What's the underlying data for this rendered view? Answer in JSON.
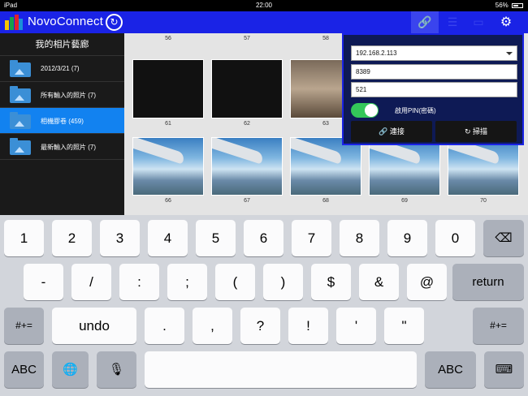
{
  "status_bar": {
    "carrier": "iPad",
    "time": "22:00",
    "battery": "56%"
  },
  "header": {
    "app_name": "NovoConnect",
    "refresh_glyph": "↻",
    "link_glyph": "🔗",
    "list_glyph": "☰",
    "screen_glyph": "▭",
    "settings_glyph": "⚙",
    "accent_color": "#1a23e6"
  },
  "sidebar": {
    "title": "我的相片藝廊",
    "items": [
      {
        "label": "2012/3/21 (7)"
      },
      {
        "label": "所有輸入的照片 (7)"
      },
      {
        "label": "相機膠卷 (459)",
        "selected": true
      },
      {
        "label": "最新輸入的照片 (7)"
      }
    ]
  },
  "gallery": {
    "row1": [
      "56",
      "57",
      "58"
    ],
    "row2": [
      "61",
      "62",
      "63"
    ],
    "row3": [
      "66",
      "67",
      "68",
      "69",
      "70"
    ]
  },
  "popover": {
    "ip_address": "192.168.2.113",
    "port": "8389",
    "pin": "521",
    "pin_label": "啟用PIN(密碼)",
    "connect_label": "連接",
    "scan_label": "掃描"
  },
  "keyboard": {
    "row1": [
      "1",
      "2",
      "3",
      "4",
      "5",
      "6",
      "7",
      "8",
      "9",
      "0"
    ],
    "delete_glyph": "⌫",
    "row2": [
      "-",
      "/",
      ":",
      ";",
      "(",
      ")",
      "$",
      "&",
      "@"
    ],
    "return_label": "return",
    "row3_left": "#+=",
    "undo_label": "undo",
    "row3": [
      ".",
      ",",
      "?",
      "!",
      "'",
      "\""
    ],
    "row3_right": "#+=",
    "abc_label": "ABC",
    "globe_glyph": "🌐",
    "mic_glyph": "🎙",
    "hide_glyph": "⌨"
  }
}
